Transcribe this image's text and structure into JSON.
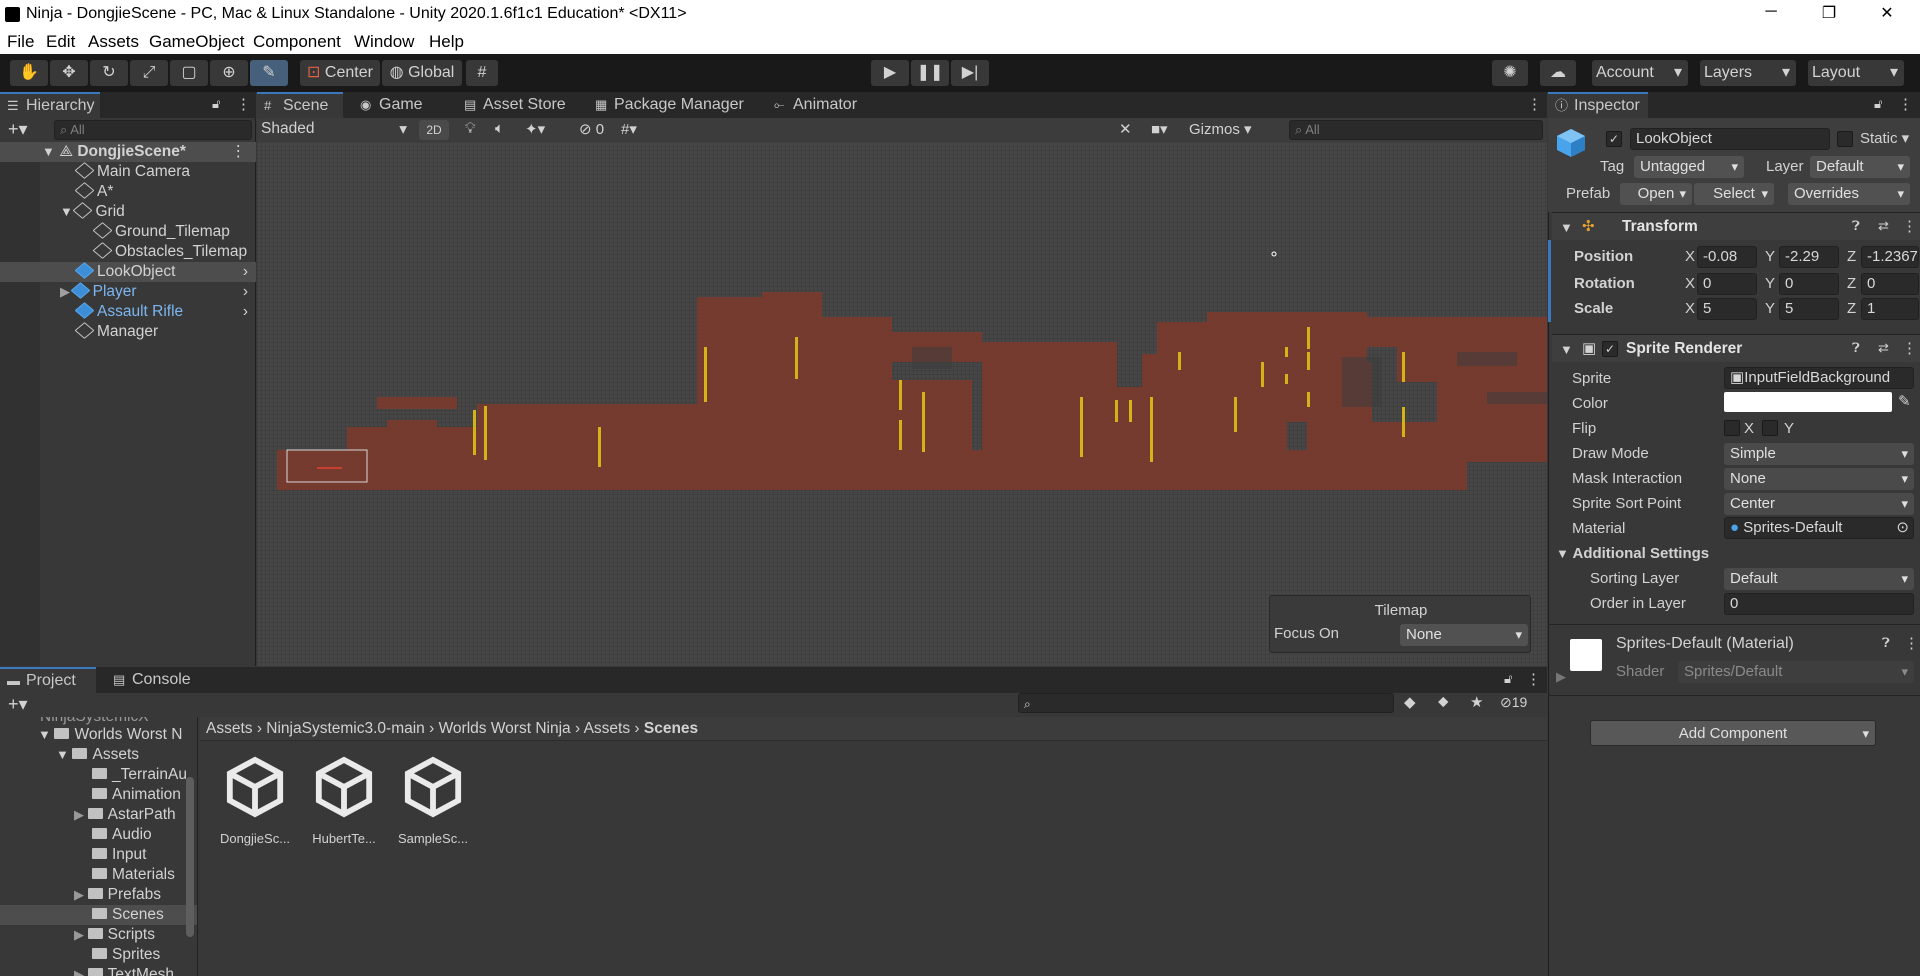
{
  "window": {
    "title": "Ninja - DongjieScene - PC, Mac & Linux Standalone - Unity 2020.1.6f1c1 Education* <DX11>",
    "controls": [
      "─",
      "❐",
      "✕"
    ]
  },
  "menu": [
    "File",
    "Edit",
    "Assets",
    "GameObject",
    "Component",
    "Window",
    "Help"
  ],
  "toolbar": {
    "pivot": "Center",
    "space": "Global",
    "account": "Account",
    "layers": "Layers",
    "layout": "Layout"
  },
  "hierarchy": {
    "tab": "Hierarchy",
    "search_placeholder": "All",
    "scene": "DongjieScene*",
    "items": [
      {
        "label": "Main Camera"
      },
      {
        "label": "A*"
      },
      {
        "label": "Grid"
      },
      {
        "label": "Ground_Tilemap"
      },
      {
        "label": "Obstacles_Tilemap"
      },
      {
        "label": "LookObject"
      },
      {
        "label": "Player"
      },
      {
        "label": "Assault Rifle"
      },
      {
        "label": "Manager"
      }
    ]
  },
  "scene_tabs": [
    "Scene",
    "Game",
    "Asset Store",
    "Package Manager",
    "Animator"
  ],
  "scene_toolbar": {
    "shading": "Shaded",
    "mode2d": "2D",
    "hidden_count": "0",
    "gizmos": "Gizmos",
    "search_placeholder": "All"
  },
  "tilemap_overlay": {
    "title": "Tilemap",
    "focus_label": "Focus On",
    "focus_value": "None"
  },
  "project": {
    "tabs": [
      "Project",
      "Console"
    ],
    "hidden_count": "19",
    "tree_cut": "NinjaSystemicX",
    "tree": [
      {
        "label": "Worlds Worst N"
      },
      {
        "label": "Assets"
      },
      {
        "label": "_TerrainAu"
      },
      {
        "label": "Animation"
      },
      {
        "label": "AstarPath"
      },
      {
        "label": "Audio"
      },
      {
        "label": "Input"
      },
      {
        "label": "Materials"
      },
      {
        "label": "Prefabs"
      },
      {
        "label": "Scenes"
      },
      {
        "label": "Scripts"
      },
      {
        "label": "Sprites"
      },
      {
        "label": "TextMesh"
      }
    ],
    "breadcrumb": [
      "Assets",
      "NinjaSystemic3.0-main",
      "Worlds Worst Ninja",
      "Assets",
      "Scenes"
    ],
    "assets": [
      "DongjieSc...",
      "HubertTe...",
      "SampleSc..."
    ]
  },
  "inspector": {
    "tab": "Inspector",
    "object_name": "LookObject",
    "static_label": "Static",
    "tag_label": "Tag",
    "tag_value": "Untagged",
    "layer_label": "Layer",
    "layer_value": "Default",
    "prefab_label": "Prefab",
    "open": "Open",
    "select": "Select",
    "overrides": "Overrides",
    "transform": {
      "title": "Transform",
      "position": {
        "label": "Position",
        "x": "-0.08",
        "y": "-2.29",
        "z": "-1.2367"
      },
      "rotation": {
        "label": "Rotation",
        "x": "0",
        "y": "0",
        "z": "0"
      },
      "scale": {
        "label": "Scale",
        "x": "5",
        "y": "5",
        "z": "1"
      }
    },
    "sprite_renderer": {
      "title": "Sprite Renderer",
      "sprite_label": "Sprite",
      "sprite_value": "InputFieldBackground",
      "color_label": "Color",
      "color_value": "#ffffff",
      "flip_label": "Flip",
      "flip_x": "X",
      "flip_y": "Y",
      "draw_mode_label": "Draw Mode",
      "draw_mode_value": "Simple",
      "mask_label": "Mask Interaction",
      "mask_value": "None",
      "sort_point_label": "Sprite Sort Point",
      "sort_point_value": "Center",
      "material_label": "Material",
      "material_value": "Sprites-Default",
      "additional": "Additional Settings",
      "sorting_layer_label": "Sorting Layer",
      "sorting_layer_value": "Default",
      "order_label": "Order in Layer",
      "order_value": "0"
    },
    "material": {
      "title": "Sprites-Default (Material)",
      "shader_label": "Shader",
      "shader_value": "Sprites/Default"
    },
    "add_component": "Add Component"
  },
  "axis": {
    "x": "X",
    "y": "Y",
    "z": "Z"
  },
  "colors": {
    "accent": "#3a79bb",
    "tilemap": "#7a3a2e",
    "obstacle": "#d4b21a",
    "prefab_text": "#7cb6f0"
  }
}
